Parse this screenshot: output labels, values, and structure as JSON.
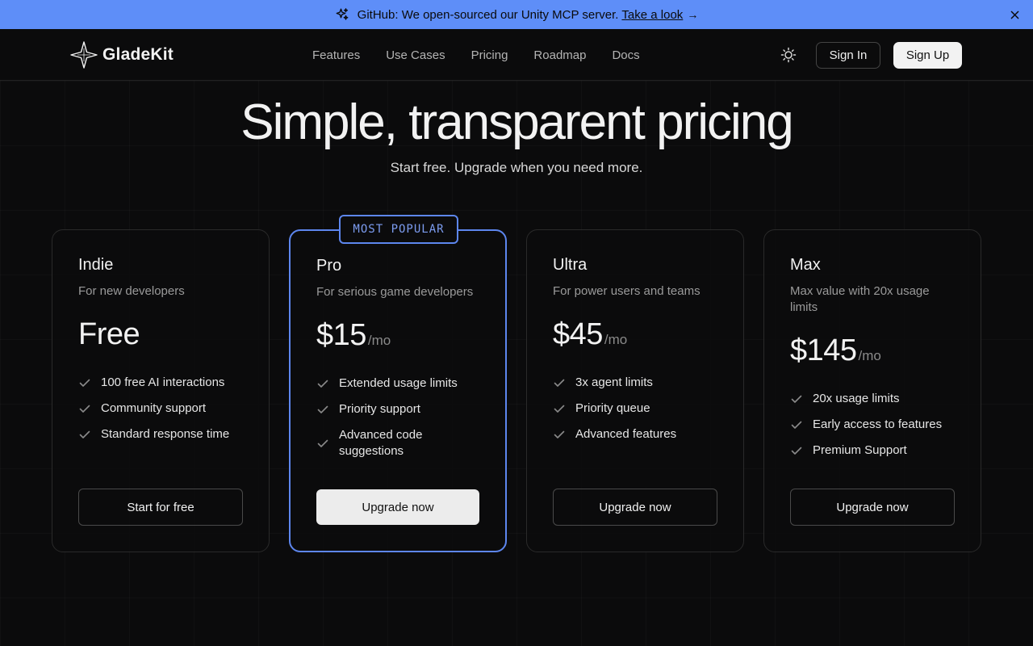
{
  "banner": {
    "icon": "sparkles-icon",
    "text": "GitHub: We open-sourced our Unity MCP server.",
    "link": "Take a look",
    "arrow": "→",
    "close_icon": "close-icon",
    "background": "#5e8ef8"
  },
  "nav": {
    "brand": "GladeKit",
    "links": [
      "Features",
      "Use Cases",
      "Pricing",
      "Roadmap",
      "Docs"
    ],
    "theme_icon": "sun-icon",
    "sign_in": "Sign In",
    "sign_up": "Sign Up"
  },
  "hero": {
    "title": "Simple, transparent pricing",
    "subtitle": "Start free. Upgrade when you need more."
  },
  "plans": [
    {
      "name": "Indie",
      "description": "For new developers",
      "price": "Free",
      "period": "",
      "features": [
        "100 free AI interactions",
        "Community support",
        "Standard response time"
      ],
      "cta": "Start for free",
      "popular": false
    },
    {
      "name": "Pro",
      "badge": "MOST POPULAR",
      "description": "For serious game developers",
      "price": "$15",
      "period": "/mo",
      "features": [
        "Extended usage limits",
        "Priority support",
        "Advanced code suggestions"
      ],
      "cta": "Upgrade now",
      "popular": true
    },
    {
      "name": "Ultra",
      "description": "For power users and teams",
      "price": "$45",
      "period": "/mo",
      "features": [
        "3x agent limits",
        "Priority queue",
        "Advanced features"
      ],
      "cta": "Upgrade now",
      "popular": false
    },
    {
      "name": "Max",
      "description": "Max value with 20x usage limits",
      "price": "$145",
      "period": "/mo",
      "features": [
        "20x usage limits",
        "Early access to features",
        "Premium Support"
      ],
      "cta": "Upgrade now",
      "popular": false
    }
  ],
  "colors": {
    "accent": "#5d86ee",
    "background": "#0b0b0c"
  }
}
